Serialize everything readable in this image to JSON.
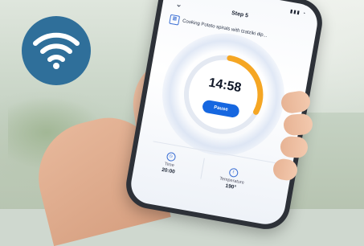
{
  "app": {
    "step_title": "Step 5",
    "recipe_label": "Cooking Potato spirals with tzatziki dip..."
  },
  "timer": {
    "value": "14:58",
    "progress_fraction": 0.3,
    "pause_label": "Pause"
  },
  "stats": {
    "time_label": "Time",
    "time_value": "20:00",
    "temp_label": "Temperature",
    "temp_value": "190°"
  },
  "icons": {
    "wifi_badge": "wifi-icon",
    "back": "chevron-down-icon",
    "recipe": "recipe-icon",
    "clock": "clock-icon",
    "thermometer": "thermometer-icon"
  },
  "colors": {
    "accent_blue": "#1667e0",
    "timer_orange": "#f5a623",
    "wifi_badge_bg": "#2f6f9a"
  }
}
